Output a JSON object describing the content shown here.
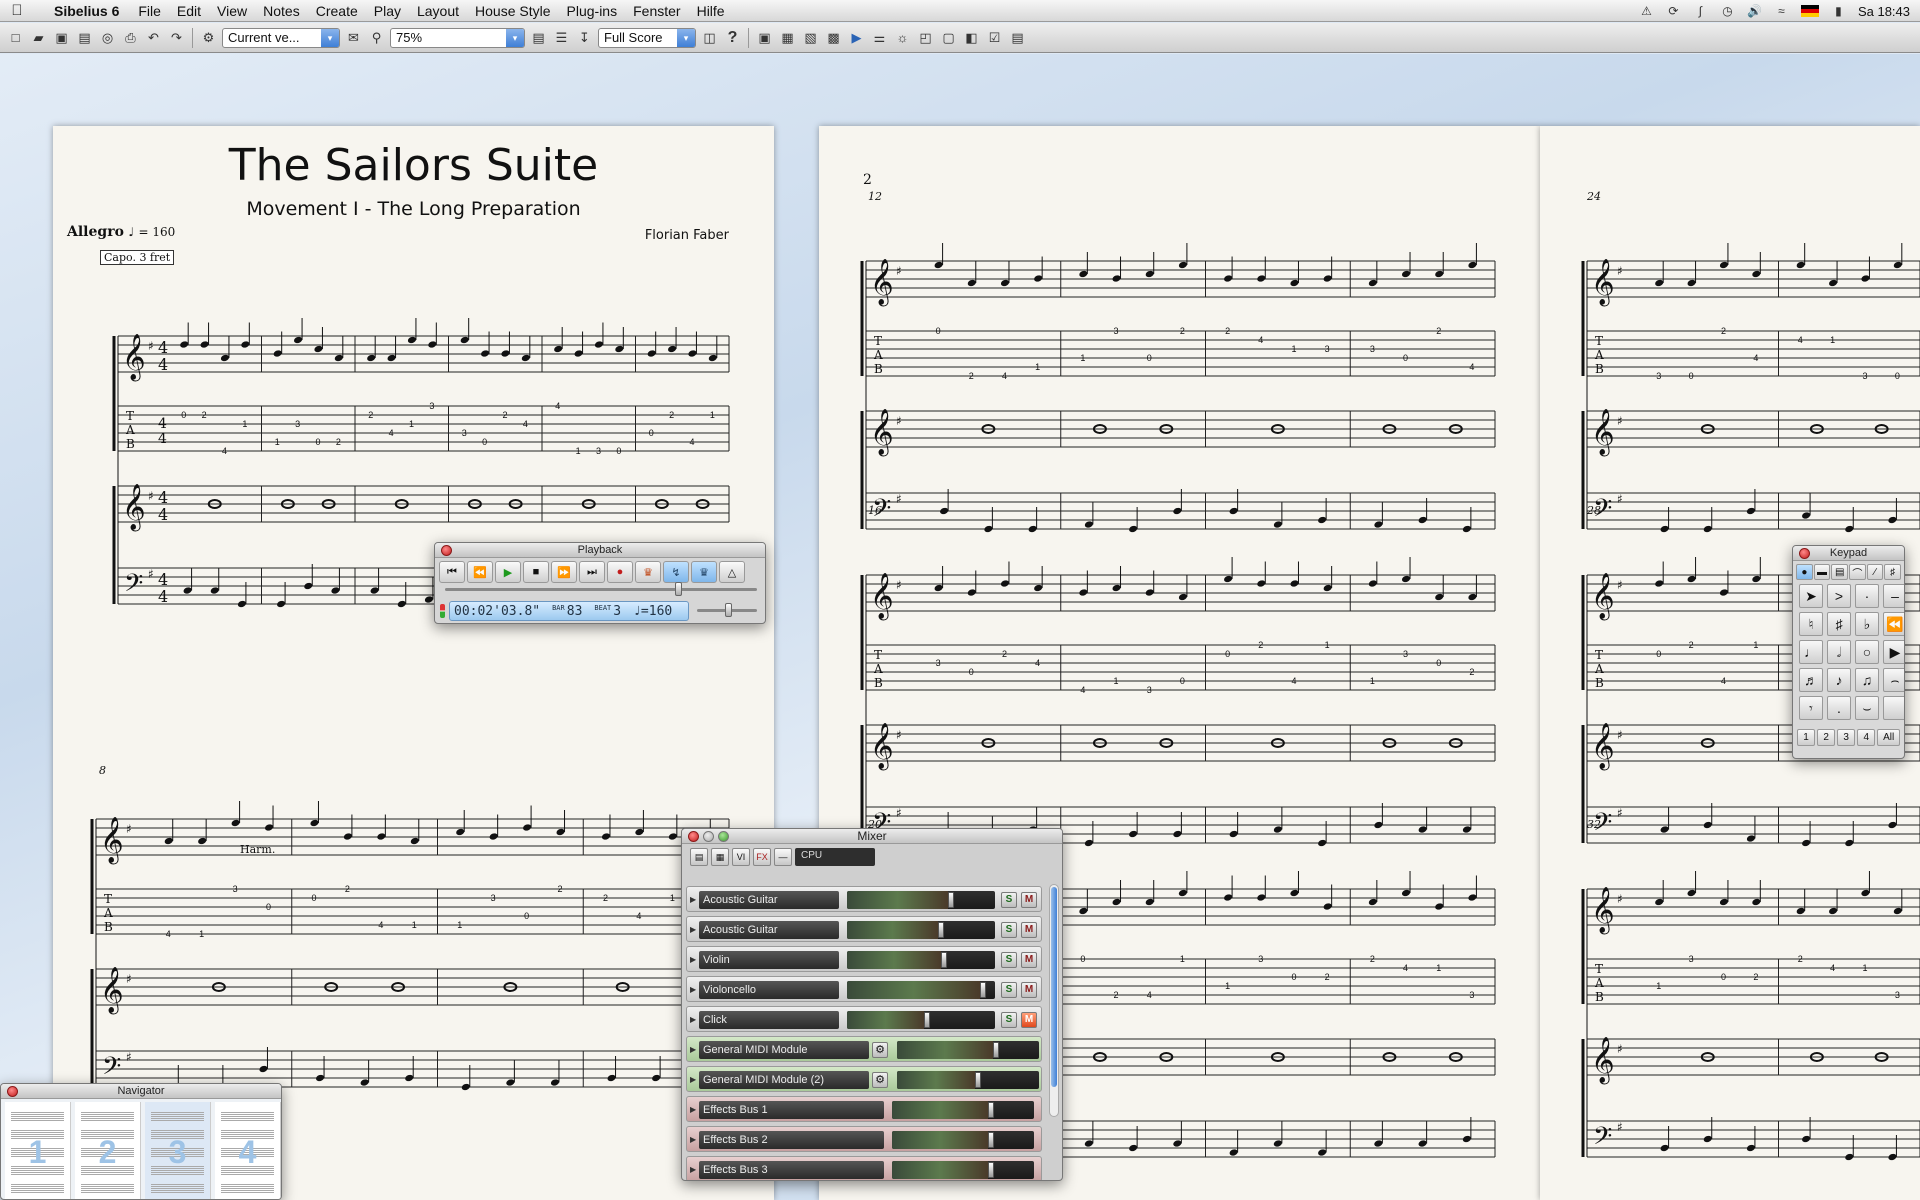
{
  "menubar": {
    "app_name": "Sibelius 6",
    "items": [
      "File",
      "Edit",
      "View",
      "Notes",
      "Create",
      "Play",
      "Layout",
      "House Style",
      "Plug-ins",
      "Fenster",
      "Hilfe"
    ],
    "clock": "Sa 18:43"
  },
  "toolbar": {
    "version_select": "Current ve...",
    "zoom_select": "75%",
    "score_select": "Full Score",
    "help_label": "?"
  },
  "score": {
    "title": "The Sailors Suite",
    "subtitle": "Movement I - The Long Preparation",
    "tempo_text": "Allegro",
    "tempo_value": "= 160",
    "composer": "Florian Faber",
    "capo_text": "Capo. 3 fret",
    "harm_text": "Harm.",
    "page2_number": "2",
    "bar_numbers_page1": [
      "8"
    ],
    "bar_numbers_page2": [
      "12",
      "16",
      "20"
    ],
    "bar_numbers_page3": [
      "24",
      "28",
      "32"
    ]
  },
  "playback": {
    "title": "Playback",
    "time": "00:02'03.8\"",
    "bar_label": "BAR",
    "bar": "83",
    "beat_label": "BEAT",
    "beat": "3",
    "tempo": "♩=160"
  },
  "mixer": {
    "title": "Mixer",
    "cpu_label": "CPU",
    "tool_labels": [
      "VI",
      "FX"
    ],
    "channels": [
      {
        "name": "Acoustic Guitar",
        "kind": "instrument",
        "level": 0.72,
        "mute": false
      },
      {
        "name": "Acoustic Guitar",
        "kind": "instrument",
        "level": 0.65,
        "mute": false
      },
      {
        "name": "Violin",
        "kind": "instrument",
        "level": 0.67,
        "mute": false
      },
      {
        "name": "Violoncello",
        "kind": "instrument",
        "level": 0.95,
        "mute": false
      },
      {
        "name": "Click",
        "kind": "instrument",
        "level": 0.55,
        "mute": true
      },
      {
        "name": "General MIDI Module",
        "kind": "midi",
        "level": 0.72
      },
      {
        "name": "General MIDI Module (2)",
        "kind": "midi",
        "level": 0.58
      },
      {
        "name": "Effects Bus 1",
        "kind": "fx",
        "level": 0.72
      },
      {
        "name": "Effects Bus 2",
        "kind": "fx",
        "level": 0.72
      },
      {
        "name": "Effects Bus 3",
        "kind": "fx",
        "level": 0.72
      }
    ],
    "solo_label": "S",
    "mute_label": "M"
  },
  "keypad": {
    "title": "Keypad",
    "tabs": [
      "1",
      "2",
      "3",
      "4",
      "All"
    ]
  },
  "navigator": {
    "title": "Navigator",
    "pages": [
      "1",
      "2",
      "3",
      "4"
    ]
  },
  "colors": {
    "accent_blue": "#3f7fd6",
    "close_red": "#c21d1d",
    "mute_active": "#e0481c"
  }
}
